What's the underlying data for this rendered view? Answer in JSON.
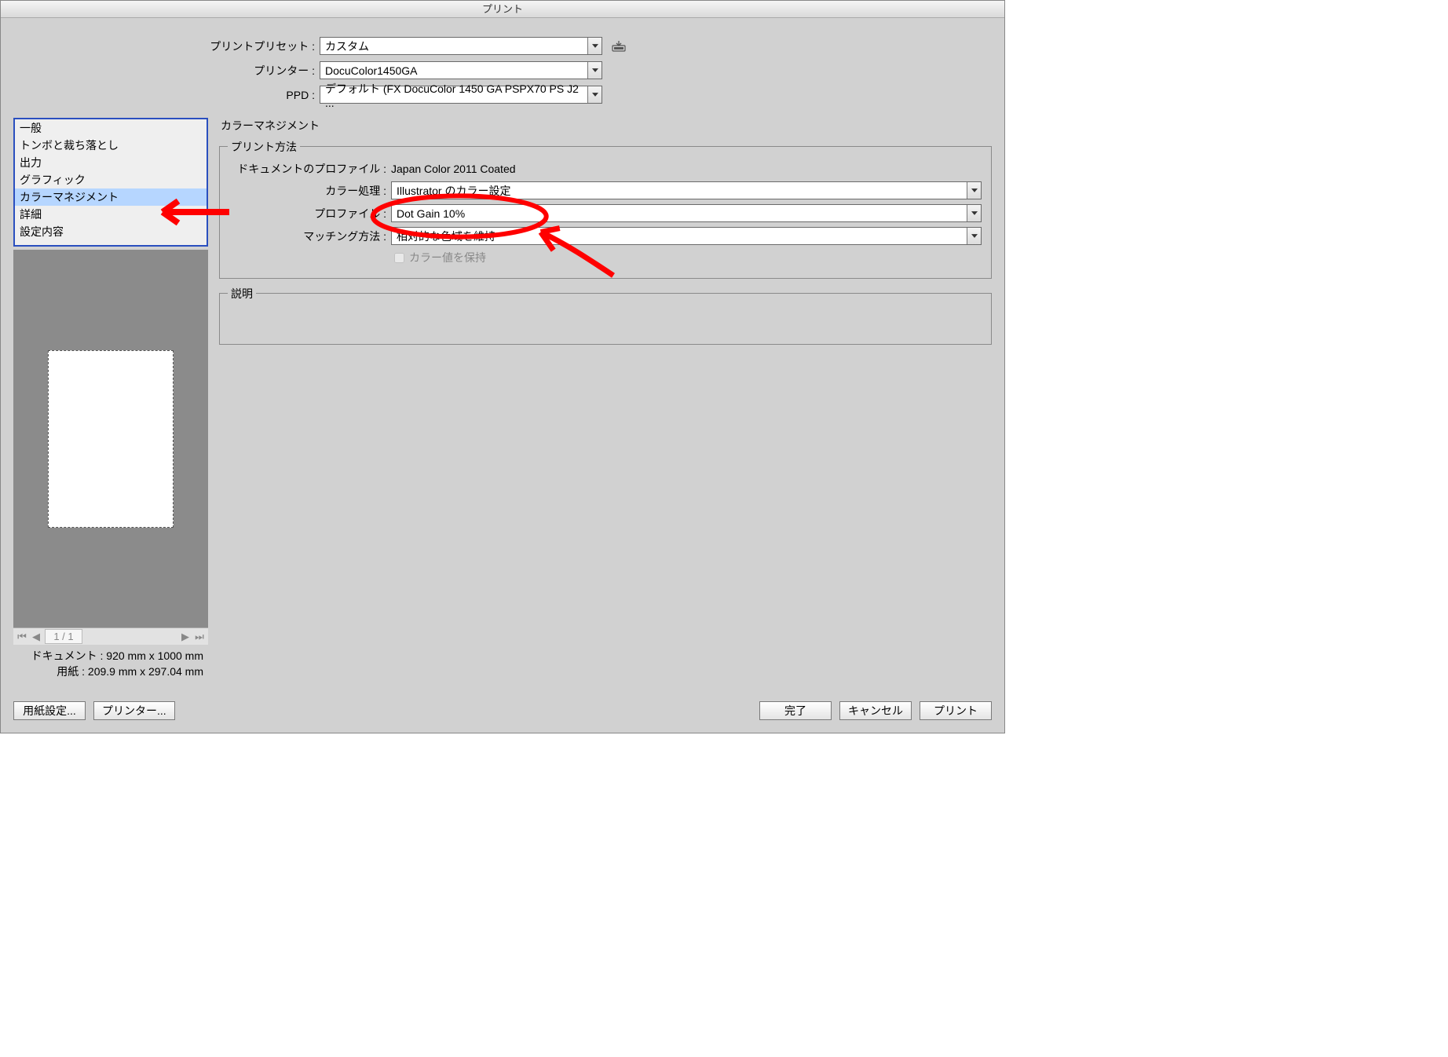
{
  "titlebar": "プリント",
  "top": {
    "preset_label": "プリントプリセット :",
    "preset_value": "カスタム",
    "printer_label": "プリンター :",
    "printer_value": "DocuColor1450GA",
    "ppd_label": "PPD :",
    "ppd_value": "デフォルト (FX DocuColor 1450 GA PSPX70 PS J2 ..."
  },
  "categories": {
    "items": [
      "一般",
      "トンボと裁ち落とし",
      "出力",
      "グラフィック",
      "カラーマネジメント",
      "詳細",
      "設定内容"
    ],
    "selected_index": 4
  },
  "preview": {
    "page_indicator": "1 / 1",
    "doc_line": "ドキュメント : 920 mm x 1000 mm",
    "paper_line": "用紙 : 209.9 mm x 297.04 mm"
  },
  "section_heading": "カラーマネジメント",
  "print_method": {
    "legend": "プリント方法",
    "doc_profile_label": "ドキュメントのプロファイル :",
    "doc_profile_value": "Japan Color 2011 Coated",
    "color_handling_label": "カラー処理 :",
    "color_handling_value": "Illustrator のカラー設定",
    "profile_label": "プロファイル :",
    "profile_value": "Dot Gain 10%",
    "intent_label": "マッチング方法 :",
    "intent_value": "相対的な色域を維持",
    "preserve_label": "カラー値を保持"
  },
  "description": {
    "legend": "説明"
  },
  "buttons": {
    "page_setup": "用紙設定...",
    "printer": "プリンター...",
    "done": "完了",
    "cancel": "キャンセル",
    "print": "プリント"
  }
}
